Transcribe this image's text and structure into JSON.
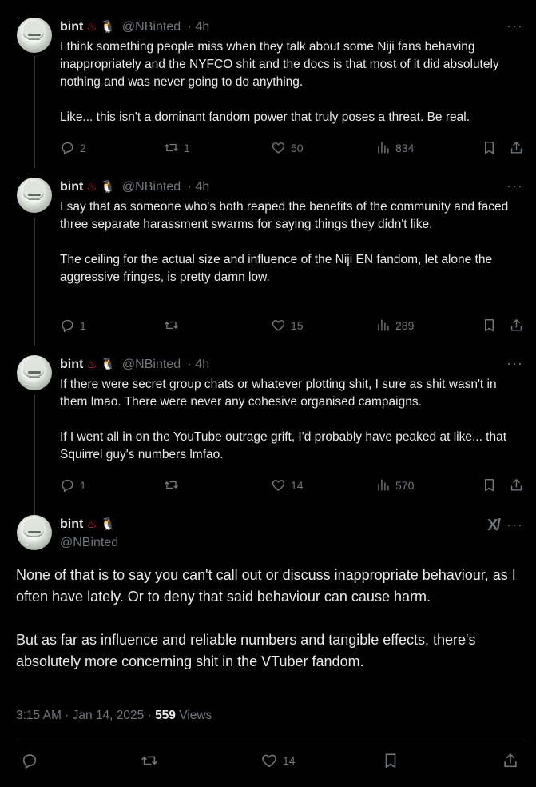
{
  "author": {
    "name": "bint",
    "emoji_1": "♨",
    "emoji_2": "🐧",
    "handle": "@NBinted"
  },
  "colors": {
    "background": "#000000",
    "text": "#e7e9ea",
    "muted": "#71767b",
    "line": "#333639"
  },
  "thread": [
    {
      "time": "· 4h",
      "text": "I think something people miss when they talk about some Niji fans behaving inappropriately and the NYFCO shit and the docs is that most of it did absolutely nothing and was never going to do anything.\n\nLike... this isn't a dominant fandom power that truly poses a threat. Be real.",
      "replies": "2",
      "reposts": "1",
      "likes": "50",
      "views": "834"
    },
    {
      "time": "· 4h",
      "text": "I say that as someone who's both reaped the benefits of the community and faced three separate harassment swarms for saying things they didn't like.\n\nThe ceiling for the actual size and influence of the Niji EN fandom, let alone the aggressive fringes, is pretty damn low.",
      "replies": "1",
      "reposts": "",
      "likes": "15",
      "views": "289"
    },
    {
      "time": "· 4h",
      "text": "If there were secret group chats or whatever plotting shit, I sure as shit wasn't in them lmao. There were never any cohesive organised campaigns.\n\nIf I went all in on the YouTube outrage grift, I'd probably have peaked at like... that Squirrel guy's numbers lmfao.",
      "replies": "1",
      "reposts": "",
      "likes": "14",
      "views": "570"
    }
  ],
  "main_tweet": {
    "text": "None of that is to say you can't call out or discuss inappropriate behaviour, as I often have lately. Or to deny that said behaviour can cause harm.\n\nBut as far as influence and reliable numbers and tangible effects, there's absolutely more concerning shit in the VTuber fandom.",
    "time": "3:15 AM · Jan 14, 2025 ·",
    "views_count": "559",
    "views_label": "Views",
    "likes": "14"
  },
  "icons": [
    "reply-icon",
    "repost-icon",
    "like-icon",
    "views-icon",
    "bookmark-icon",
    "share-icon",
    "more-icon",
    "grok-icon"
  ]
}
